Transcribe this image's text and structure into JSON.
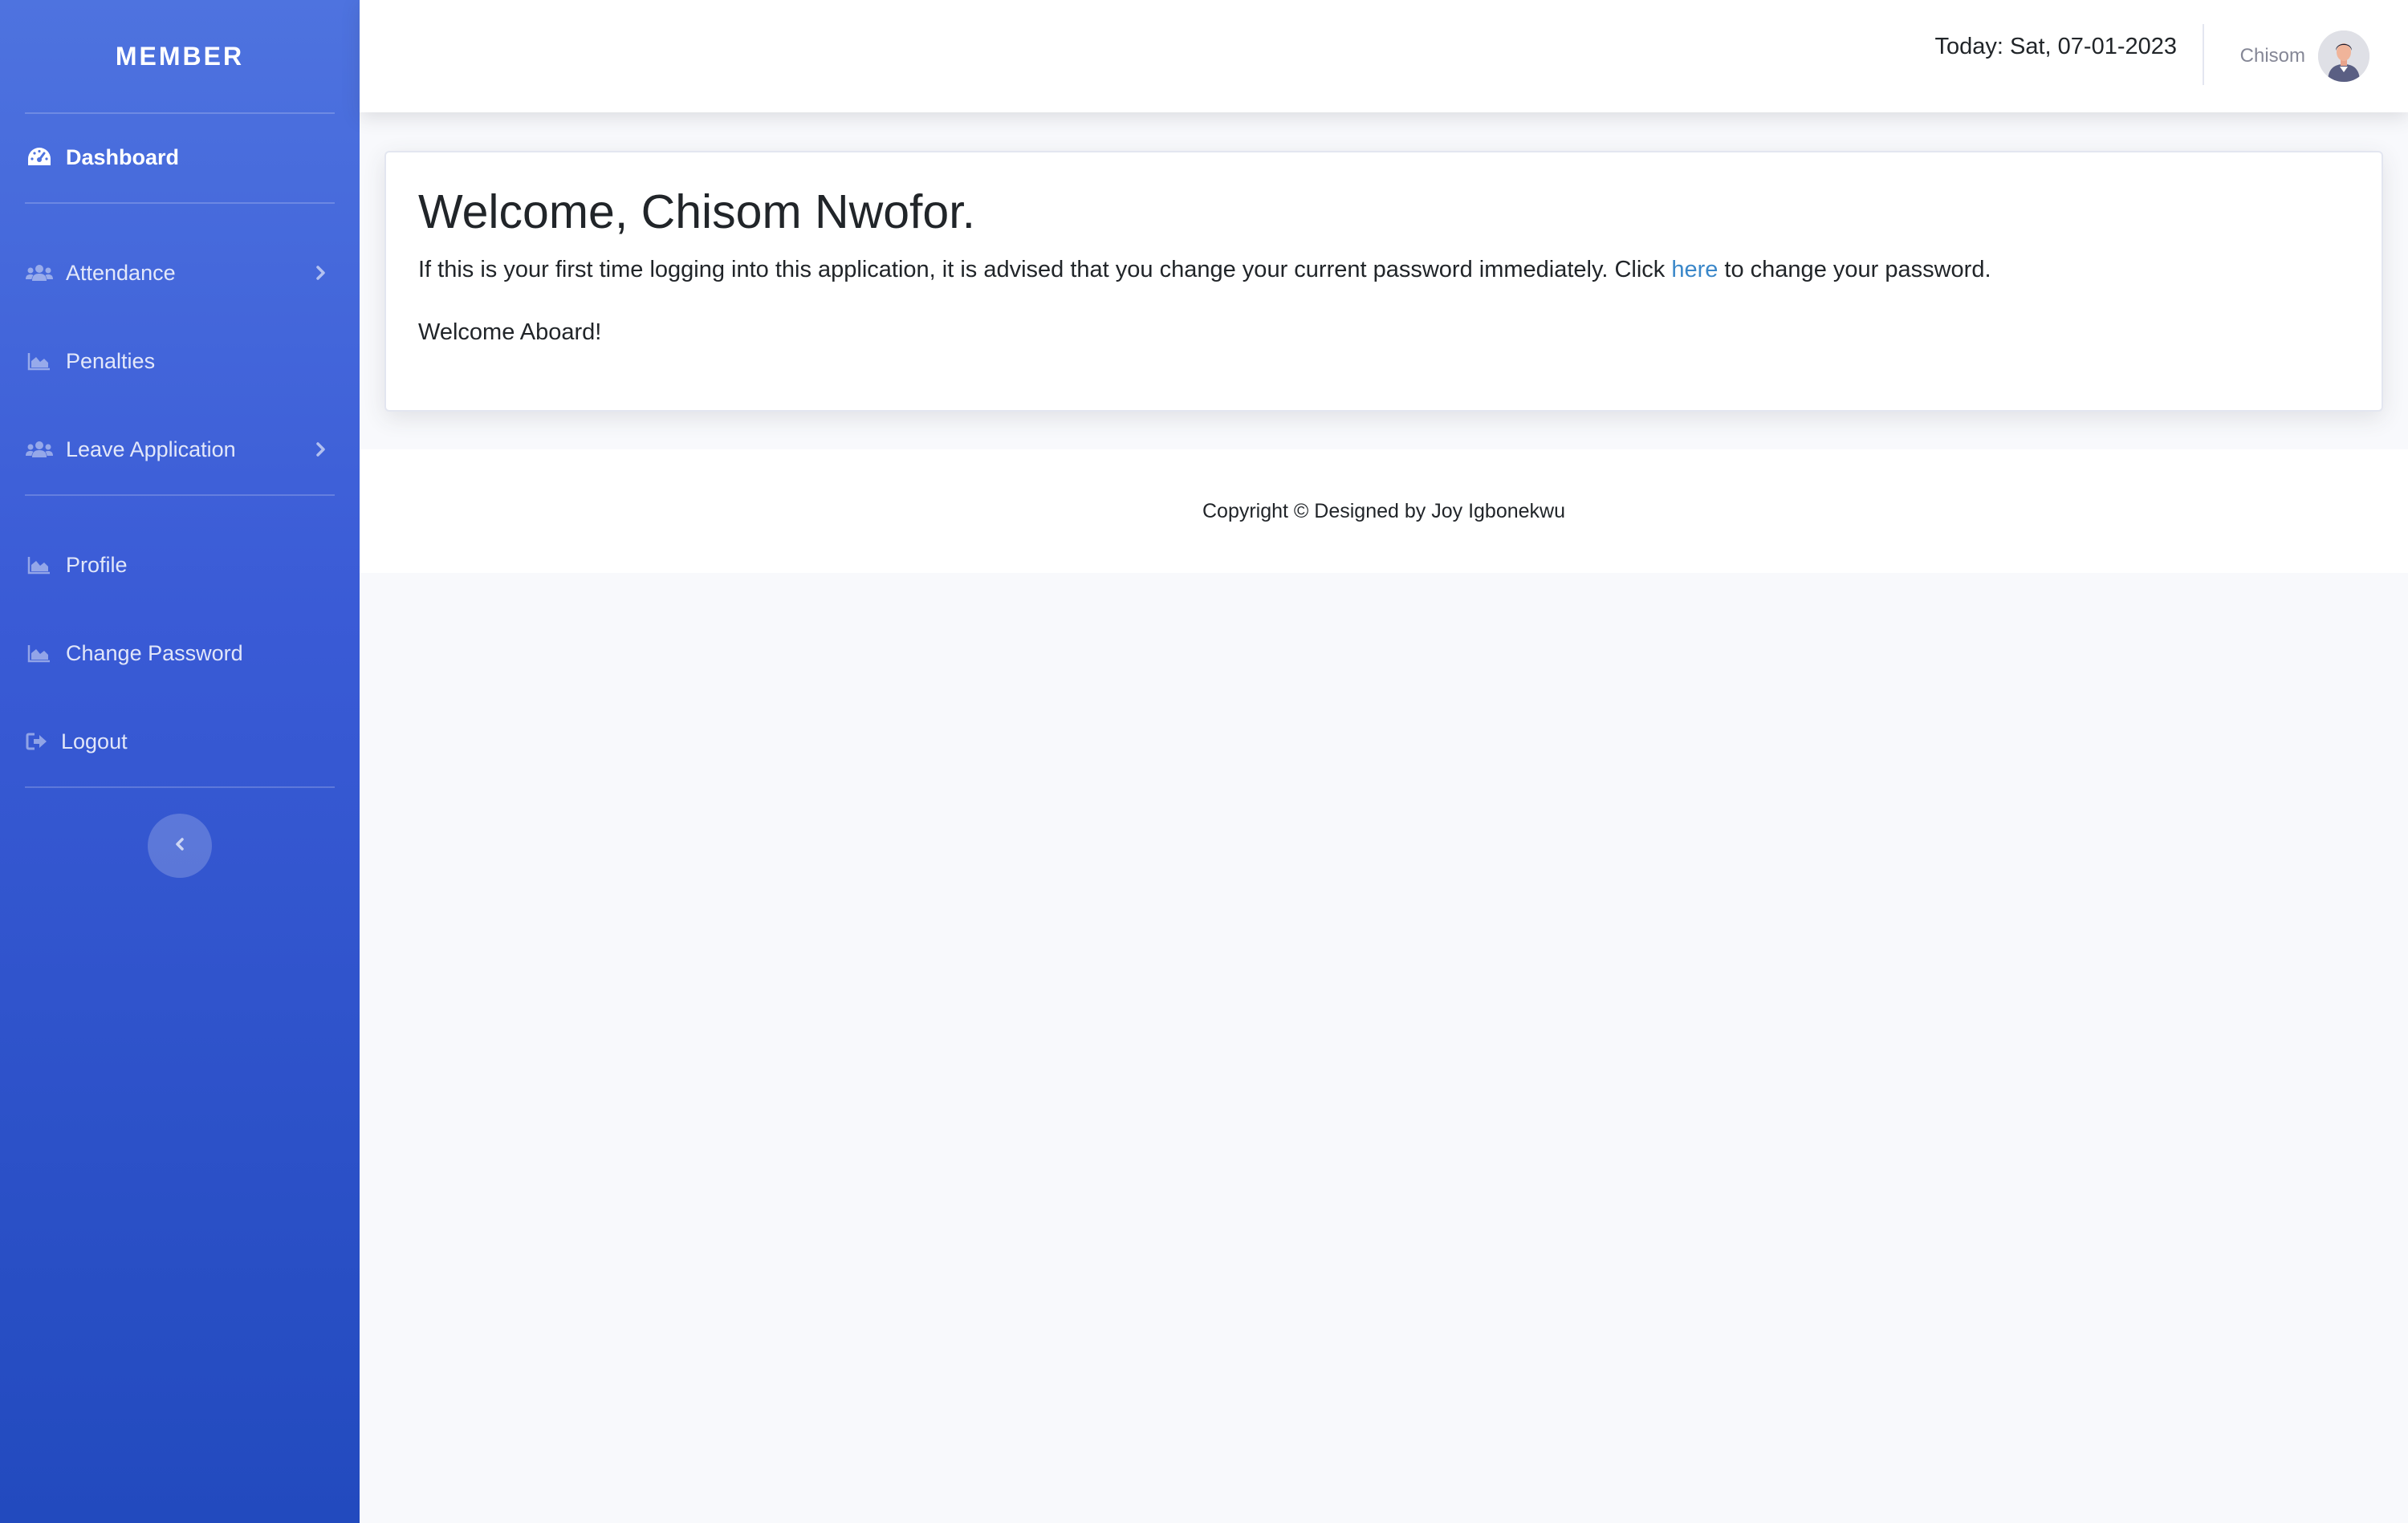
{
  "sidebar": {
    "brand": "MEMBER",
    "items": [
      {
        "label": "Dashboard",
        "icon": "tachometer-icon",
        "active": true
      },
      {
        "label": "Attendance",
        "icon": "users-icon",
        "has_submenu": true
      },
      {
        "label": "Penalties",
        "icon": "chart-area-icon"
      },
      {
        "label": "Leave Application",
        "icon": "users-icon",
        "has_submenu": true
      },
      {
        "label": "Profile",
        "icon": "chart-area-icon"
      },
      {
        "label": "Change Password",
        "icon": "chart-area-icon"
      },
      {
        "label": "Logout",
        "icon": "sign-out-icon"
      }
    ],
    "toggle_icon": "chevron-left-icon"
  },
  "topbar": {
    "today": "Today: Sat, 07-01-2023",
    "user_name": "Chisom",
    "avatar_icon": "user-avatar"
  },
  "card": {
    "title": "Welcome, Chisom Nwofor.",
    "text_before_link": "If this is your first time logging into this application, it is advised that you change your current password immediately. Click ",
    "link_text": "here",
    "text_after_link": " to change your password.",
    "text2": "Welcome Aboard!"
  },
  "footer": {
    "text": "Copyright © Designed by Joy Igbonekwu"
  },
  "colors": {
    "sidebar_top": "#4e73df",
    "sidebar_bottom": "#224abe",
    "link": "#3a87c9",
    "page_bg": "#f8f9fc"
  }
}
